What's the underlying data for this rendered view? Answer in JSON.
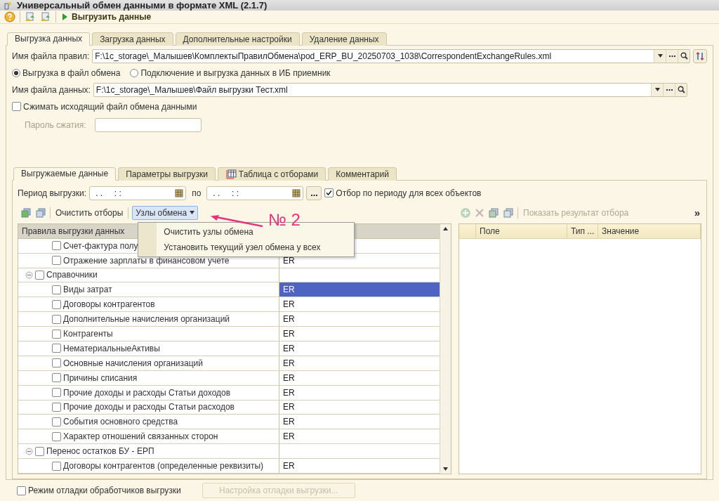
{
  "window": {
    "title": "Универсальный обмен данными в формате XML (2.1.7)"
  },
  "toolbar": {
    "run_button": "Выгрузить данные"
  },
  "tabs": [
    {
      "label": "Выгрузка данных",
      "selected": true
    },
    {
      "label": "Загрузка данных",
      "selected": false
    },
    {
      "label": "Дополнительные настройки",
      "selected": false
    },
    {
      "label": "Удаление данных",
      "selected": false
    }
  ],
  "rules_file": {
    "label": "Имя файла правил:",
    "value": "F:\\1c_storage\\_Малышев\\КомплектыПравилОбмена\\pod_ERP_BU_20250703_1038\\CorrespondentExchangeRules.xml"
  },
  "modes": [
    {
      "label": "Выгрузка в файл обмена",
      "selected": true
    },
    {
      "label": "Подключение и выгрузка данных в ИБ приемник",
      "selected": false
    }
  ],
  "data_file": {
    "label": "Имя файла данных:",
    "value": "F:\\1c_storage\\_Малышев\\Файл выгрузки Тест.xml"
  },
  "compress": {
    "label": "Сжимать исходящий файл обмена данными",
    "checked": false
  },
  "password": {
    "label": "Пароль сжатия:",
    "disabled": true
  },
  "inner_tabs": [
    {
      "label": "Выгружаемые данные",
      "selected": true
    },
    {
      "label": "Параметры выгрузки",
      "selected": false
    },
    {
      "label": "Таблица с отборами",
      "selected": false,
      "kind": "icon"
    },
    {
      "label": "Комментарий",
      "selected": false
    }
  ],
  "period": {
    "label": "Период выгрузки:",
    "from": ". .     : :",
    "to_label": "по",
    "to": ". .     : :",
    "filter_all": {
      "label": "Отбор по периоду для всех объектов",
      "checked": true
    }
  },
  "rules_toolbar": {
    "clear": "Очистить отборы",
    "nodes_button": {
      "label": "Узлы обмена",
      "expanded": true
    },
    "nodes_menu": [
      "Очистить узлы обмена",
      "Установить текущий узел обмена у всех"
    ]
  },
  "tree": {
    "column_1": "Правила выгрузки данных",
    "rows": [
      {
        "children": [
          {
            "label": "Счет-фактура полу",
            "checked": false,
            "selected": false
          },
          {
            "label": "Отражение зарплаты в финансовом учете",
            "checked": false,
            "value": "ER",
            "selected": false
          }
        ]
      },
      {
        "label": "Справочники",
        "checked": false,
        "expanded": true,
        "children": [
          {
            "label": "Виды затрат",
            "checked": false,
            "value": "ER",
            "selected": true
          },
          {
            "label": "Договоры контрагентов",
            "checked": false,
            "value": "ER",
            "selected": false
          },
          {
            "label": "Дополнительные начисления организаций",
            "checked": false,
            "value": "ER",
            "selected": false
          },
          {
            "label": "Контрагенты",
            "checked": false,
            "value": "ER",
            "selected": false
          },
          {
            "label": "НематериальныеАктивы",
            "checked": false,
            "value": "ER",
            "selected": false
          },
          {
            "label": "Основные начисления организаций",
            "checked": false,
            "value": "ER",
            "selected": false
          },
          {
            "label": "Причины списания",
            "checked": false,
            "value": "ER",
            "selected": false
          },
          {
            "label": "Прочие доходы и расходы Статьи доходов",
            "checked": false,
            "value": "ER",
            "selected": false
          },
          {
            "label": "Прочие доходы и расходы Статьи расходов",
            "checked": false,
            "value": "ER",
            "selected": false
          },
          {
            "label": "События основного средства",
            "checked": false,
            "value": "ER",
            "selected": false
          },
          {
            "label": "Характер отношений связанных сторон",
            "checked": false,
            "value": "ER",
            "selected": false
          }
        ]
      },
      {
        "label": "Перенос остатков БУ - ЕРП",
        "checked": false,
        "expanded": true,
        "children": [
          {
            "label": "Договоры контрагентов (определенные реквизиты)",
            "checked": false,
            "value": "ER",
            "selected": false
          }
        ]
      }
    ]
  },
  "filter_toolbar": {
    "show_result": {
      "label": "Показать результат отбора",
      "disabled": true
    },
    "more": "»"
  },
  "filter_table": {
    "columns": [
      "Поле",
      "Тип ...",
      "Значение"
    ]
  },
  "debug": {
    "label": "Режим отладки обработчиков выгрузки",
    "checked": false
  },
  "debug_button": {
    "label": "Настройка отладки выгрузки...",
    "disabled": true
  },
  "annotation": "№ 2"
}
